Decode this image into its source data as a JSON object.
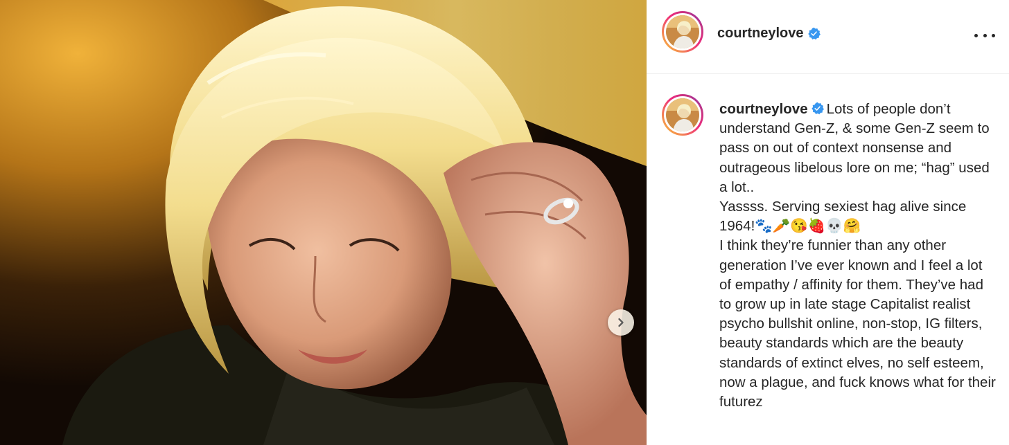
{
  "post": {
    "author": {
      "username": "courtneylove",
      "verified": true,
      "verified_icon": "verified-badge-icon",
      "verified_color": "#3897f0"
    },
    "media": {
      "next_icon": "chevron-right-icon"
    },
    "header": {
      "more_icon": "more-options-icon"
    },
    "caption": {
      "lines": [
        "Lots of people don’t understand Gen-Z, & some Gen-Z seem to pass on out of context nonsense and outrageous libelous lore on me; “hag” used a lot..",
        "Yassss. Serving sexiest hag alive since 1964!🐾🥕😘🍓💀🤗",
        "I think they’re funnier than any other generation I’ve ever known and I feel a lot of empathy / affinity for them. They’ve had to grow up in late stage Capitalist realist psycho bullshit online, non-stop, IG filters, beauty standards which are the beauty standards of extinct elves, no self esteem, now a plague, and fuck knows what for their futurez"
      ]
    },
    "colors": {
      "text": "#262626",
      "ring_gradient": [
        "#f9ce34",
        "#ee2a7b",
        "#6228d7"
      ]
    }
  }
}
